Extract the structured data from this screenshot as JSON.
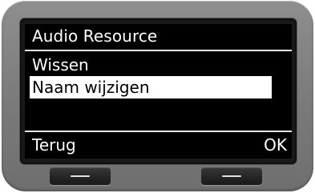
{
  "screen": {
    "title": "Audio Resource",
    "menu_items": [
      {
        "label": "Wissen",
        "selected": false
      },
      {
        "label": "Naam wijzigen",
        "selected": true
      }
    ]
  },
  "softkeys": {
    "left_label": "Terug",
    "right_label": "OK",
    "left_key_icon": "minus-bar-icon",
    "right_key_icon": "minus-bar-icon"
  },
  "colors": {
    "screen_background": "#000000",
    "screen_text": "#ffffff",
    "selection_background": "#ffffff",
    "selection_text": "#000000",
    "device_body": "#7a7a7a"
  }
}
